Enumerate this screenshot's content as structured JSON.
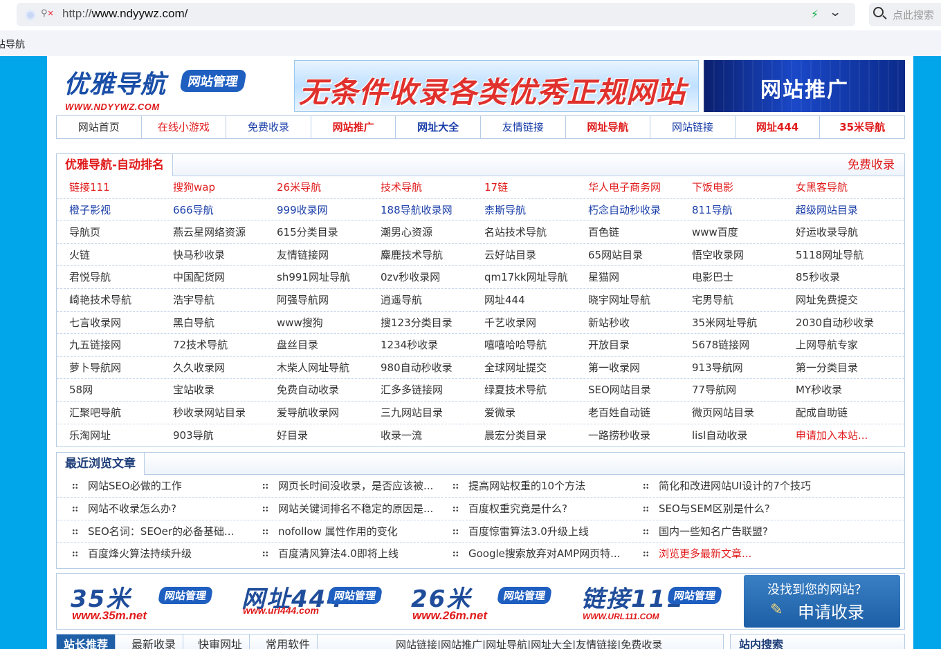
{
  "browser": {
    "url_prefix": "http://",
    "url_domain": "www.ndyywz.com/",
    "search_placeholder": "点此搜索",
    "favorite": "站导航"
  },
  "header": {
    "logo_main": "优雅导航",
    "logo_tag": "网站管理",
    "logo_domain": "WWW.NDYYWZ.COM",
    "banner_text": "无条件收录各类优秀正规网站",
    "promo_text": "网站推广"
  },
  "nav": [
    {
      "label": "网站首页",
      "color": "#333333",
      "bold": false
    },
    {
      "label": "在线小游戏",
      "color": "#e01b1b",
      "bold": false
    },
    {
      "label": "免费收录",
      "color": "#1a3ea8",
      "bold": false
    },
    {
      "label": "网站推广",
      "color": "#e01b1b",
      "bold": true
    },
    {
      "label": "网址大全",
      "color": "#1a3ea8",
      "bold": true
    },
    {
      "label": "友情链接",
      "color": "#1a3ea8",
      "bold": false
    },
    {
      "label": "网址导航",
      "color": "#e01b1b",
      "bold": true
    },
    {
      "label": "网站链接",
      "color": "#1a3ea8",
      "bold": false
    },
    {
      "label": "网址444",
      "color": "#e01b1b",
      "bold": true
    },
    {
      "label": "35米导航",
      "color": "#e01b1b",
      "bold": true
    }
  ],
  "sites": {
    "title": "优雅导航-自动排名",
    "more": "免费收录",
    "rows": [
      {
        "color": "#e01b1b",
        "items": [
          "链接111",
          "搜狗wap",
          "26米导航",
          "技术导航",
          "17链",
          "华人电子商务网",
          "下饭电影",
          "女黑客导航"
        ]
      },
      {
        "color": "#1a3ea8",
        "items": [
          "橙子影视",
          "666导航",
          "999收录网",
          "188导航收录网",
          "柰斯导航",
          "朽念自动秒收录",
          "811导航",
          "超级网站目录"
        ]
      },
      {
        "color": "#333333",
        "items": [
          "导航页",
          "燕云星网络资源",
          "615分类目录",
          "潮男心资源",
          "名站技术导航",
          "百色链",
          "www百度",
          "好运收录导航"
        ]
      },
      {
        "color": "#333333",
        "items": [
          "火链",
          "快马秒收录",
          "友情链接网",
          "麋鹿技术导航",
          "云好站目录",
          "65网站目录",
          "悟空收录网",
          "5118网址导航"
        ]
      },
      {
        "color": "#333333",
        "items": [
          "君悦导航",
          "中国配货网",
          "sh991网址导航",
          "0zv秒收录网",
          "qm17kk网址导航",
          "星猫网",
          "电影巴士",
          "85秒收录"
        ]
      },
      {
        "color": "#333333",
        "items": [
          "崎艳技术导航",
          "浩宇导航",
          "阿强导航网",
          "逍遥导航",
          "网址444",
          "晓宇网址导航",
          "宅男导航",
          "网址免费提交"
        ]
      },
      {
        "color": "#333333",
        "items": [
          "七言收录网",
          "黑白导航",
          "www搜狗",
          "搜123分类目录",
          "千艺收录网",
          "新站秒收",
          "35米网址导航",
          "2030自动秒收录"
        ]
      },
      {
        "color": "#333333",
        "items": [
          "九五链接网",
          "72技术导航",
          "盘丝目录",
          "1234秒收录",
          "嘻嘻哈哈导航",
          "开放目录",
          "5678链接网",
          "上网导航专家"
        ]
      },
      {
        "color": "#333333",
        "items": [
          "萝卜导航网",
          "久久收录网",
          "木柴人网址导航",
          "980自动秒收录",
          "全球网址提交",
          "第一收录网",
          "913导航网",
          "第一分类目录"
        ]
      },
      {
        "color": "#333333",
        "items": [
          "58网",
          "宝站收录",
          "免费自动收录",
          "汇多多链接网",
          "绿夏技术导航",
          "SEO网站目录",
          "77导航网",
          "MY秒收录"
        ]
      },
      {
        "color": "#333333",
        "items": [
          "汇聚吧导航",
          "秒收录网站目录",
          "爱导航收录网",
          "三九网站目录",
          "爱微录",
          "老百姓自动链",
          "微页网站目录",
          "配成自助链"
        ]
      },
      {
        "color": "#333333",
        "items": [
          "乐淘网址",
          "903导航",
          "好目录",
          "收录一流",
          "晨宏分类目录",
          "一路捞秒收录",
          "lisl自动收录",
          "申请加入本站..."
        ]
      }
    ]
  },
  "articles": {
    "title": "最近浏览文章",
    "rows": [
      [
        "网站SEO必做的工作",
        "网页长时间没收录，是否应该被...",
        "提高网站权重的10个方法",
        "简化和改进网站UI设计的7个技巧"
      ],
      [
        "网站不收录怎么办?",
        "网站关键词排名不稳定的原因是...",
        "百度权重究竟是什么?",
        "SEO与SEM区别是什么?"
      ],
      [
        "SEO名词：SEOer的必备基础...",
        "nofollow 属性作用的变化",
        "百度惊雷算法3.0升级上线",
        "国内一些知名广告联盟?"
      ],
      [
        "百度烽火算法持续升级",
        "百度清风算法4.0即将上线",
        "Google搜索放弃对AMP网页特...",
        "浏览更多最新文章..."
      ]
    ]
  },
  "partners": [
    {
      "big": "35米",
      "badge": "网站管理",
      "dom": "www.35m.net"
    },
    {
      "big": "网址444",
      "badge": "网站管理",
      "dom": "www.url444.com"
    },
    {
      "big": "26米",
      "badge": "网站管理",
      "dom": "www.26m.net"
    },
    {
      "big": "链接111",
      "badge": "网站管理",
      "dom": "WWW.URL111.COM"
    }
  ],
  "apply": {
    "question": "没找到您的网站？",
    "action": "申请收录"
  },
  "bottom": {
    "tabs": [
      "站长推荐",
      "最新收录",
      "快审网址",
      "常用软件"
    ],
    "links": "网站链接|网站推广|网址导航|网址大全|友情链接|免费收录",
    "search_title": "站内搜索"
  }
}
